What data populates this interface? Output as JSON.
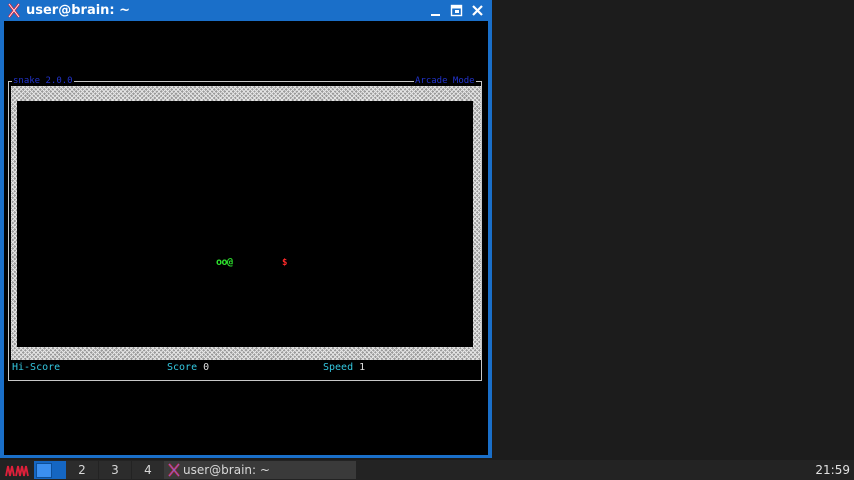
{
  "window": {
    "title": "user@brain: ~",
    "icon": "x-terminal-icon",
    "controls": {
      "minimize": "minimize-icon",
      "maximize": "maximize-icon",
      "close": "close-icon"
    }
  },
  "game": {
    "header_left": "snake 2.0.0",
    "header_right": "Arcade Mode",
    "snake": "oo@",
    "food": "$",
    "hiscore_label": "Hi-Score",
    "hiscore_value": "",
    "score_label": "Score",
    "score_value": "0",
    "speed_label": "Speed",
    "speed_value": "1"
  },
  "taskbar": {
    "start_icon": "jwm-menu-icon",
    "workspaces": [
      "",
      "2",
      "3",
      "4"
    ],
    "active_workspace": 1,
    "task_label": "user@brain: ~",
    "task_icon": "x-terminal-icon",
    "clock": "21:59"
  },
  "colors": {
    "titlebar": "#1a6fc9",
    "snake": "#2ee62e",
    "food": "#ff2a2a",
    "status_label": "#34c8e0",
    "header_text": "#2233cc"
  }
}
